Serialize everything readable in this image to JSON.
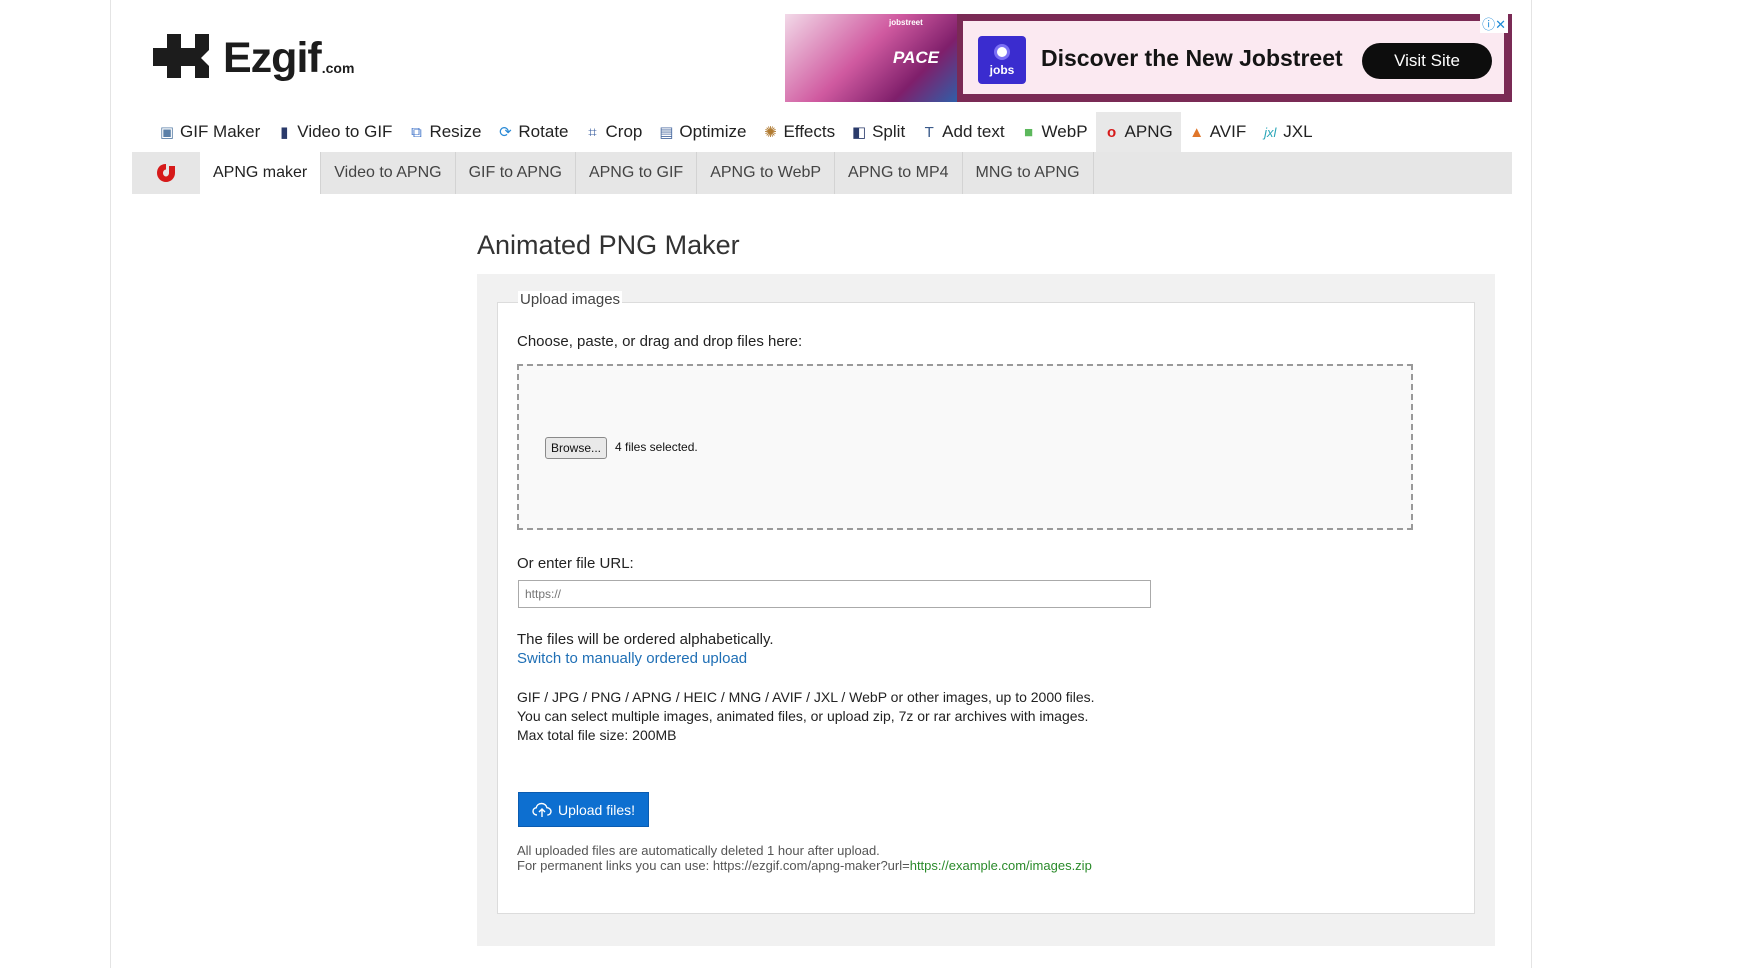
{
  "logo": {
    "word": "Ezgif",
    "suffix": ".com"
  },
  "ad": {
    "thumb_tag": "jobstreet",
    "thumb_text": "PACE",
    "brand_label": "jobs",
    "headline": "Discover the New Jobstreet",
    "cta": "Visit Site",
    "ad_controls": "ⓘ✕"
  },
  "topnav": {
    "items": [
      {
        "label": "GIF Maker",
        "icon": "gif-maker-icon"
      },
      {
        "label": "Video to GIF",
        "icon": "video-to-gif-icon"
      },
      {
        "label": "Resize",
        "icon": "resize-icon"
      },
      {
        "label": "Rotate",
        "icon": "rotate-icon"
      },
      {
        "label": "Crop",
        "icon": "crop-icon"
      },
      {
        "label": "Optimize",
        "icon": "optimize-icon"
      },
      {
        "label": "Effects",
        "icon": "effects-icon"
      },
      {
        "label": "Split",
        "icon": "split-icon"
      },
      {
        "label": "Add text",
        "icon": "add-text-icon"
      },
      {
        "label": "WebP",
        "icon": "webp-icon"
      },
      {
        "label": "APNG",
        "icon": "apng-icon",
        "active": true
      },
      {
        "label": "AVIF",
        "icon": "avif-icon"
      },
      {
        "label": "JXL",
        "icon": "jxl-icon"
      }
    ]
  },
  "subnav": {
    "tabs": [
      {
        "label": "APNG maker",
        "active": true
      },
      {
        "label": "Video to APNG"
      },
      {
        "label": "GIF to APNG"
      },
      {
        "label": "APNG to GIF"
      },
      {
        "label": "APNG to WebP"
      },
      {
        "label": "APNG to MP4"
      },
      {
        "label": "MNG to APNG"
      }
    ]
  },
  "main": {
    "title": "Animated PNG Maker",
    "legend": "Upload images",
    "choose_label": "Choose, paste, or drag and drop files here:",
    "browse_label": "Browse...",
    "files_selected": "4 files selected.",
    "url_label": "Or enter file URL:",
    "url_placeholder": "https://",
    "order_note": "The files will be ordered alphabetically.",
    "switch_link": "Switch to manually ordered upload",
    "formats_line1": "GIF / JPG / PNG / APNG / HEIC / MNG / AVIF / JXL / WebP or other images, up to 2000 files.",
    "formats_line2": "You can select multiple images, animated files, or upload zip, 7z or rar archives with images.",
    "formats_line3": "Max total file size: 200MB",
    "upload_button": "Upload files!",
    "delete_note": "All uploaded files are automatically deleted 1 hour after upload.",
    "permalink_prefix": "For permanent links you can use: https://ezgif.com/apng-maker?url=",
    "permalink_example": "https://example.com/images.zip"
  },
  "colors": {
    "accent_blue": "#0d6fd0",
    "link_blue": "#1f6fb5",
    "apng_red": "#d61a1a",
    "example_green": "#2a8a2a"
  }
}
